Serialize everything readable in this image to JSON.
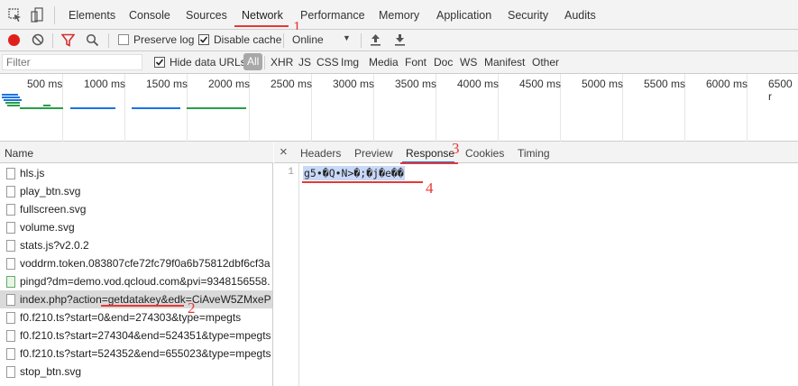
{
  "devtools": {
    "tabs": [
      "Elements",
      "Console",
      "Sources",
      "Network",
      "Performance",
      "Memory",
      "Application",
      "Security",
      "Audits"
    ],
    "active_tab": "Network"
  },
  "toolbar": {
    "preserve_log_label": "Preserve log",
    "preserve_log_checked": false,
    "disable_cache_label": "Disable cache",
    "disable_cache_checked": true,
    "throttle_value": "Online"
  },
  "filterbar": {
    "filter_placeholder": "Filter",
    "hide_data_urls_label": "Hide data URLs",
    "hide_data_urls_checked": true,
    "types": [
      "All",
      "XHR",
      "JS",
      "CSS",
      "Img",
      "Media",
      "Font",
      "Doc",
      "WS",
      "Manifest",
      "Other"
    ],
    "active_type": "All"
  },
  "timeline": {
    "ticks": [
      "500 ms",
      "1000 ms",
      "1500 ms",
      "2000 ms",
      "2500 ms",
      "3000 ms",
      "3500 ms",
      "4000 ms",
      "4500 ms",
      "5000 ms",
      "5500 ms",
      "6000 ms",
      "6500 r"
    ]
  },
  "requests": {
    "header": "Name",
    "items": [
      {
        "name": "hls.js",
        "kind": "file"
      },
      {
        "name": "play_btn.svg",
        "kind": "file"
      },
      {
        "name": "fullscreen.svg",
        "kind": "file"
      },
      {
        "name": "volume.svg",
        "kind": "file"
      },
      {
        "name": "stats.js?v2.0.2",
        "kind": "file"
      },
      {
        "name": "voddrm.token.083807cfe72fc79f0a6b75812dbf6cf3aa...",
        "kind": "file"
      },
      {
        "name": "pingd?dm=demo.vod.qcloud.com&pvi=9348156558...",
        "kind": "image"
      },
      {
        "name": "index.php?action=getdatakey&edk=CiAveW5ZMxeP...",
        "kind": "file",
        "selected": true
      },
      {
        "name": "f0.f210.ts?start=0&end=274303&type=mpegts",
        "kind": "file"
      },
      {
        "name": "f0.f210.ts?start=274304&end=524351&type=mpegts",
        "kind": "file"
      },
      {
        "name": "f0.f210.ts?start=524352&end=655023&type=mpegts",
        "kind": "file"
      },
      {
        "name": "stop_btn.svg",
        "kind": "file"
      }
    ]
  },
  "detail": {
    "close_glyph": "×",
    "tabs": [
      "Headers",
      "Preview",
      "Response",
      "Cookies",
      "Timing"
    ],
    "active_tab": "Response",
    "line_number": "1",
    "response_text": "g5•�Q•N>�;�j�e��"
  },
  "annotations": {
    "colors": {
      "annotation": "#e53935",
      "highlight": "#1a73e8",
      "selection": "#c8d8f8"
    },
    "labels": [
      "1",
      "2",
      "3",
      "4"
    ]
  }
}
